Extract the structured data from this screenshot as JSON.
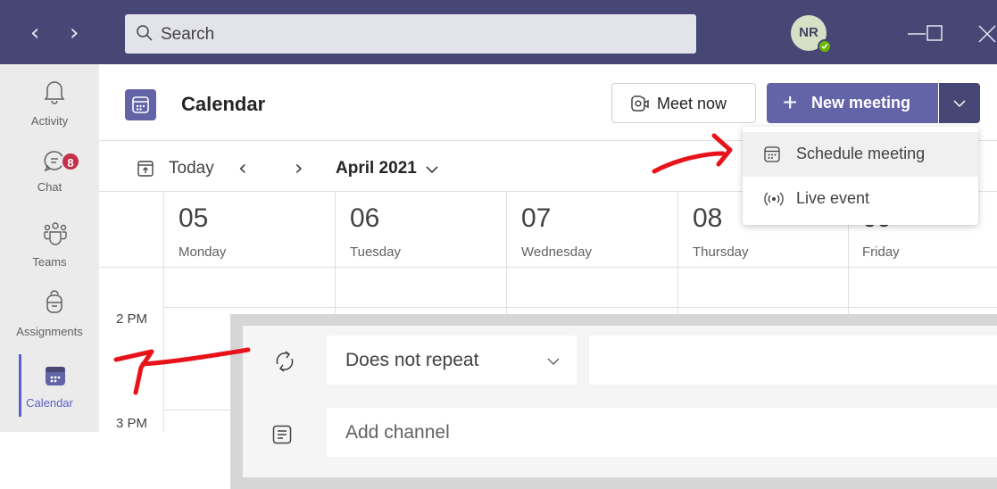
{
  "search": {
    "placeholder": "Search"
  },
  "user": {
    "initials": "NR",
    "status": "available"
  },
  "rail": {
    "items": [
      {
        "label": "Activity",
        "icon": "bell-icon"
      },
      {
        "label": "Chat",
        "icon": "chat-icon",
        "badge": "8"
      },
      {
        "label": "Teams",
        "icon": "teams-icon"
      },
      {
        "label": "Assignments",
        "icon": "backpack-icon"
      },
      {
        "label": "Calendar",
        "icon": "calendar-icon",
        "active": true
      }
    ]
  },
  "header": {
    "title": "Calendar",
    "meet_now": "Meet now",
    "new_meeting": "New meeting"
  },
  "toolbar": {
    "today": "Today",
    "month": "April 2021"
  },
  "days": [
    {
      "num": "05",
      "name": "Monday"
    },
    {
      "num": "06",
      "name": "Tuesday"
    },
    {
      "num": "07",
      "name": "Wednesday"
    },
    {
      "num": "08",
      "name": "Thursday"
    },
    {
      "num": "09",
      "name": "Friday"
    }
  ],
  "times": [
    "2 PM",
    "3 PM"
  ],
  "dropdown": {
    "items": [
      {
        "label": "Schedule meeting",
        "icon": "calendar-icon"
      },
      {
        "label": "Live event",
        "icon": "broadcast-icon"
      }
    ]
  },
  "panel": {
    "repeat": "Does not repeat",
    "channel": "Add channel"
  },
  "colors": {
    "titlebar": "#464775",
    "accent": "#6264a7",
    "accent_dark": "#464775",
    "badge": "#c4314b",
    "annotation": "#e8121a"
  }
}
